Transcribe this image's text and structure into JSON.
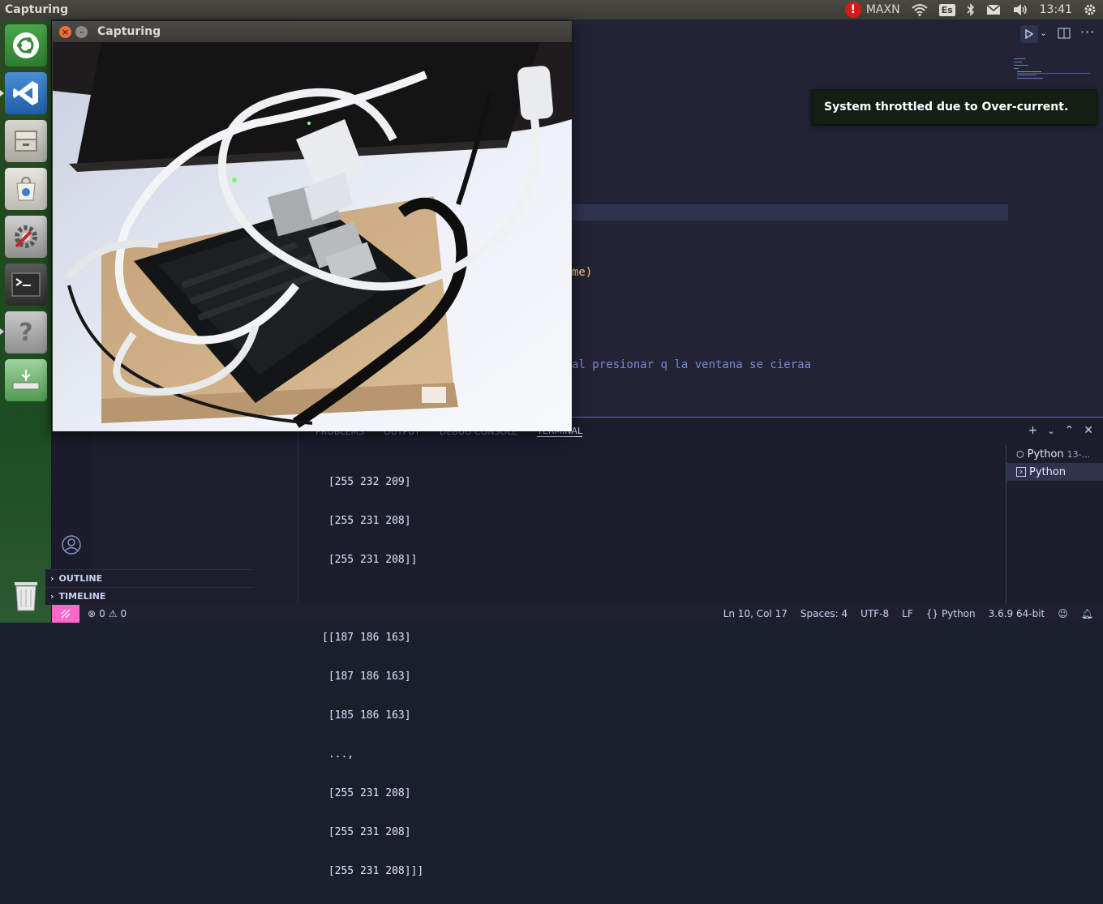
{
  "top_panel": {
    "app_title": "Capturing",
    "power_mode": "MAXN",
    "keyboard_layout": "Es",
    "clock": "13:41"
  },
  "launcher": {
    "items": [
      "ubuntu-dash",
      "vscode",
      "file-manager",
      "software-center",
      "system-settings",
      "terminal",
      "help",
      "usb-installer",
      "trash"
    ]
  },
  "capture_window": {
    "title": "Capturing",
    "close_glyph": "×",
    "minimize_glyph": "–"
  },
  "editor": {
    "line_fragment_1": "me)",
    "line_fragment_2": "al presionar q la ventana se cieraa"
  },
  "notification": {
    "text": "System throttled due to Over-current."
  },
  "panel": {
    "tabs": [
      "PROBLEMS",
      "OUTPUT",
      "DEBUG CONSOLE",
      "TERMINAL"
    ],
    "terminal_lines": [
      " [255 232 209]",
      " [255 231 208]",
      " [255 231 208]]",
      "",
      "[[187 186 163]",
      " [187 186 163]",
      " [185 186 163]",
      " ...,",
      " [255 231 208]",
      " [255 231 208]",
      " [255 231 208]]]"
    ],
    "terminals": [
      {
        "name": "Python",
        "sub": "13-..."
      },
      {
        "name": "Python",
        "sub": ""
      }
    ]
  },
  "sidebar": {
    "outline": "OUTLINE",
    "timeline": "TIMELINE"
  },
  "statusbar": {
    "errors": "0",
    "warnings": "0",
    "position": "Ln 10, Col 17",
    "spaces": "Spaces: 4",
    "encoding": "UTF-8",
    "eol": "LF",
    "language": "Python",
    "interpreter": "3.6.9 64-bit"
  }
}
